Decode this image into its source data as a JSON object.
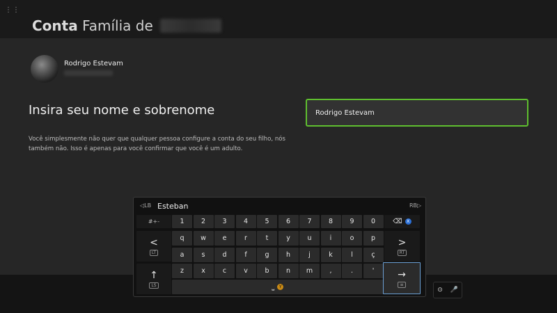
{
  "header": {
    "title_strong": "Conta",
    "title_rest": "Família de"
  },
  "user": {
    "name": "Rodrigo Estevam"
  },
  "form": {
    "heading": "Insira seu nome e sobrenome",
    "description": "Você simplesmente não quer que qualquer pessoa configure a conta do seu filho, nós também não. Isso é apenas para você confirmar que você é um adulto.",
    "name_value": "Rodrigo Estevam"
  },
  "keyboard": {
    "suggestion": "Esteban",
    "symbols_label": "#+-",
    "number_row": [
      "1",
      "2",
      "3",
      "4",
      "5",
      "6",
      "7",
      "8",
      "9",
      "0"
    ],
    "row1": [
      "q",
      "w",
      "e",
      "r",
      "t",
      "y",
      "u",
      "i",
      "o",
      "p"
    ],
    "row2": [
      "a",
      "s",
      "d",
      "f",
      "g",
      "h",
      "j",
      "k",
      "l",
      "ç"
    ],
    "row3": [
      "z",
      "x",
      "c",
      "v",
      "b",
      "n",
      "m",
      ",",
      ".",
      "'"
    ],
    "left_arrow": "<",
    "right_arrow": ">",
    "up_arrow": "↑",
    "enter_arrow": "→",
    "backspace_glyph": "⌫",
    "space_glyph": "⎵",
    "x_badge": "X",
    "y_badge": "Y"
  },
  "icons": {
    "menu": "grip-dots-icon",
    "mic": "microphone-icon"
  },
  "colors": {
    "focus_green": "#5fbf2f",
    "enter_blue": "#6a9fd4",
    "x_button": "#2a6fd6",
    "y_button": "#c98a15"
  }
}
